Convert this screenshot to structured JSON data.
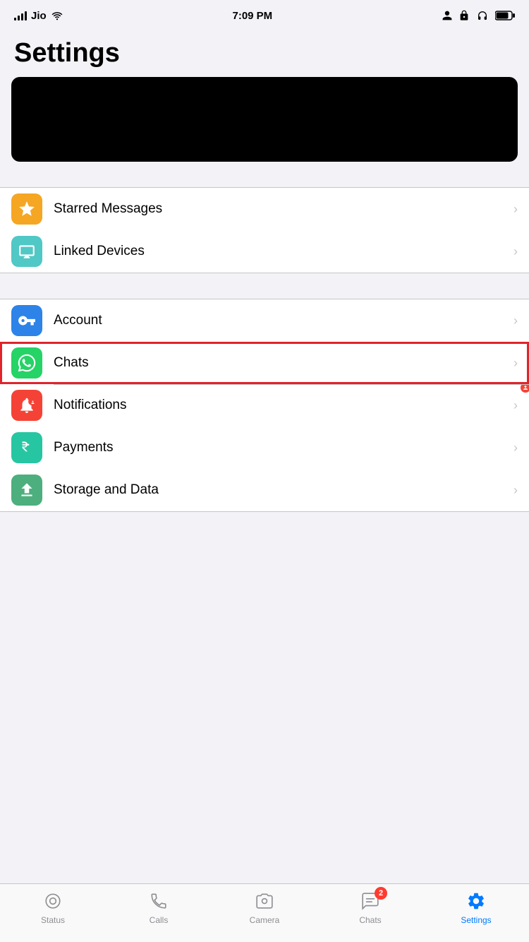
{
  "statusBar": {
    "carrier": "Jio",
    "time": "7:09 PM"
  },
  "pageTitle": "Settings",
  "sections": [
    {
      "id": "section1",
      "rows": [
        {
          "id": "starred-messages",
          "label": "Starred Messages",
          "iconColor": "#f5a623",
          "iconType": "star"
        },
        {
          "id": "linked-devices",
          "label": "Linked Devices",
          "iconColor": "#50c8c6",
          "iconType": "monitor"
        }
      ]
    },
    {
      "id": "section2",
      "rows": [
        {
          "id": "account",
          "label": "Account",
          "iconColor": "#2d83e8",
          "iconType": "key"
        },
        {
          "id": "chats",
          "label": "Chats",
          "iconColor": "#25d366",
          "iconType": "whatsapp",
          "highlighted": true
        },
        {
          "id": "notifications",
          "label": "Notifications",
          "iconColor": "#f44336",
          "iconType": "bell"
        },
        {
          "id": "payments",
          "label": "Payments",
          "iconColor": "#26c6a2",
          "iconType": "rupee"
        },
        {
          "id": "storage-data",
          "label": "Storage and Data",
          "iconColor": "#4caf7d",
          "iconType": "upload"
        }
      ]
    }
  ],
  "tabBar": {
    "items": [
      {
        "id": "status",
        "label": "Status",
        "active": false,
        "badge": null
      },
      {
        "id": "calls",
        "label": "Calls",
        "active": false,
        "badge": null
      },
      {
        "id": "camera",
        "label": "Camera",
        "active": false,
        "badge": null
      },
      {
        "id": "chats",
        "label": "Chats",
        "active": false,
        "badge": "2"
      },
      {
        "id": "settings",
        "label": "Settings",
        "active": true,
        "badge": null
      }
    ]
  }
}
